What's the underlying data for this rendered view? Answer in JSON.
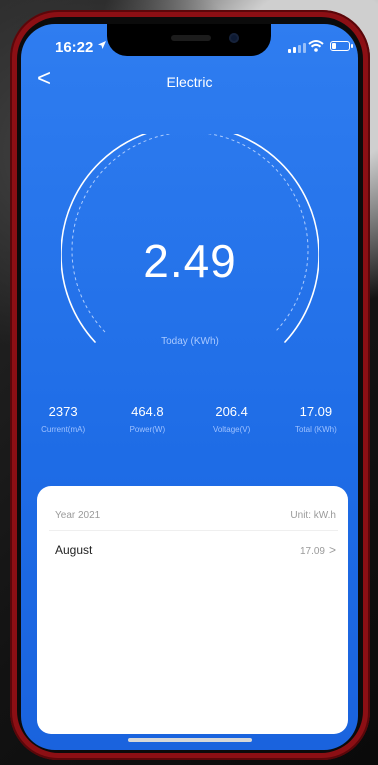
{
  "status_bar": {
    "time": "16:22",
    "location_icon": "location-arrow-icon",
    "signal_icon": "cellular-signal-icon",
    "wifi_icon": "wifi-icon",
    "battery_icon": "battery-icon"
  },
  "nav": {
    "back_icon": "back-chevron-icon",
    "back_glyph": "<",
    "title": "Electric"
  },
  "gauge": {
    "value": "2.49",
    "label": "Today (KWh)"
  },
  "stats": [
    {
      "value": "2373",
      "label": "Current(mA)"
    },
    {
      "value": "464.8",
      "label": "Power(W)"
    },
    {
      "value": "206.4",
      "label": "Voltage(V)"
    },
    {
      "value": "17.09",
      "label": "Total (KWh)"
    }
  ],
  "history": {
    "year_label": "Year 2021",
    "unit_label": "Unit: kW.h",
    "rows": [
      {
        "month": "August",
        "value": "17.09",
        "chevron": ">"
      }
    ]
  },
  "colors": {
    "accent_blue": "#2f7df0",
    "card_bg": "#ffffff",
    "phone_frame": "#8c0f14"
  }
}
